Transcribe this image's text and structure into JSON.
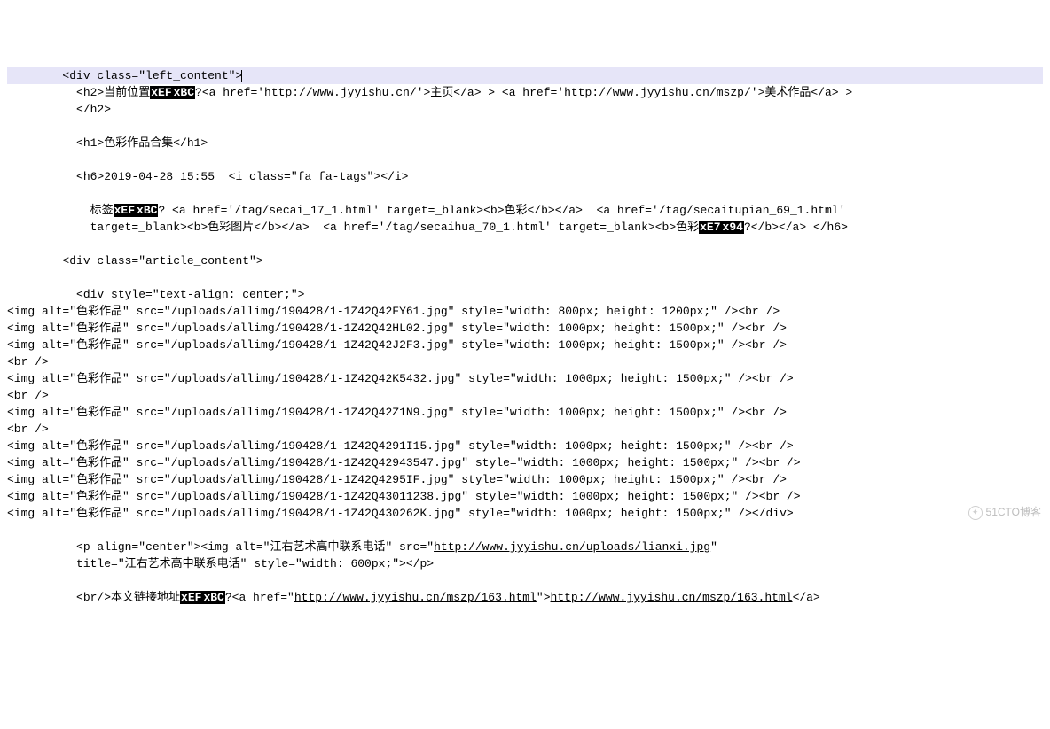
{
  "lines": [
    {
      "indent": "        ",
      "highlight": true,
      "segments": [
        {
          "t": "plain",
          "v": "<div class=\"left_content\">"
        },
        {
          "t": "caret"
        }
      ]
    },
    {
      "indent": "          ",
      "segments": [
        {
          "t": "plain",
          "v": "<h2>当前位置"
        },
        {
          "t": "hex",
          "v": "xEF"
        },
        {
          "t": "hex",
          "v": "xBC"
        },
        {
          "t": "plain",
          "v": "?<a href='"
        },
        {
          "t": "url",
          "v": "http://www.jyyishu.cn/"
        },
        {
          "t": "plain",
          "v": "'>主页</a> > <a href='"
        },
        {
          "t": "url",
          "v": "http://www.jyyishu.cn/mszp/"
        },
        {
          "t": "plain",
          "v": "'>美术作品</a> >"
        }
      ]
    },
    {
      "indent": "          ",
      "segments": [
        {
          "t": "plain",
          "v": "</h2>"
        }
      ]
    },
    {
      "indent": "",
      "segments": [
        {
          "t": "plain",
          "v": ""
        }
      ]
    },
    {
      "indent": "          ",
      "segments": [
        {
          "t": "plain",
          "v": "<h1>色彩作品合集</h1>"
        }
      ]
    },
    {
      "indent": "",
      "segments": [
        {
          "t": "plain",
          "v": ""
        }
      ]
    },
    {
      "indent": "          ",
      "segments": [
        {
          "t": "plain",
          "v": "<h6>2019-04-28 15:55  <i class=\"fa fa-tags\"></i>"
        }
      ]
    },
    {
      "indent": "",
      "segments": [
        {
          "t": "plain",
          "v": ""
        }
      ]
    },
    {
      "indent": "            ",
      "segments": [
        {
          "t": "plain",
          "v": "标签"
        },
        {
          "t": "hex",
          "v": "xEF"
        },
        {
          "t": "hex",
          "v": "xBC"
        },
        {
          "t": "plain",
          "v": "? <a href='/tag/secai_17_1.html' target=_blank><b>色彩</b></a>  <a href='/tag/secaitupian_69_1.html'"
        }
      ]
    },
    {
      "indent": "            ",
      "segments": [
        {
          "t": "plain",
          "v": "target=_blank><b>色彩图片</b></a>  <a href='/tag/secaihua_70_1.html' target=_blank><b>色彩"
        },
        {
          "t": "hex",
          "v": "xE7"
        },
        {
          "t": "hex",
          "v": "x94"
        },
        {
          "t": "plain",
          "v": "?</b></a> </h6>"
        }
      ]
    },
    {
      "indent": "",
      "segments": [
        {
          "t": "plain",
          "v": ""
        }
      ]
    },
    {
      "indent": "        ",
      "segments": [
        {
          "t": "plain",
          "v": "<div class=\"article_content\">"
        }
      ]
    },
    {
      "indent": "",
      "segments": [
        {
          "t": "plain",
          "v": ""
        }
      ]
    },
    {
      "indent": "          ",
      "segments": [
        {
          "t": "plain",
          "v": "<div style=\"text-align: center;\">"
        }
      ]
    },
    {
      "indent": "",
      "segments": [
        {
          "t": "plain",
          "v": "<img alt=\"色彩作品\" src=\"/uploads/allimg/190428/1-1Z42Q42FY61.jpg\" style=\"width: 800px; height: 1200px;\" /><br />"
        }
      ]
    },
    {
      "indent": "",
      "segments": [
        {
          "t": "plain",
          "v": "<img alt=\"色彩作品\" src=\"/uploads/allimg/190428/1-1Z42Q42HL02.jpg\" style=\"width: 1000px; height: 1500px;\" /><br />"
        }
      ]
    },
    {
      "indent": "",
      "segments": [
        {
          "t": "plain",
          "v": "<img alt=\"色彩作品\" src=\"/uploads/allimg/190428/1-1Z42Q42J2F3.jpg\" style=\"width: 1000px; height: 1500px;\" /><br />"
        }
      ]
    },
    {
      "indent": "",
      "segments": [
        {
          "t": "plain",
          "v": "<br />"
        }
      ]
    },
    {
      "indent": "",
      "segments": [
        {
          "t": "plain",
          "v": "<img alt=\"色彩作品\" src=\"/uploads/allimg/190428/1-1Z42Q42K5432.jpg\" style=\"width: 1000px; height: 1500px;\" /><br />"
        }
      ]
    },
    {
      "indent": "",
      "segments": [
        {
          "t": "plain",
          "v": "<br />"
        }
      ]
    },
    {
      "indent": "",
      "segments": [
        {
          "t": "plain",
          "v": "<img alt=\"色彩作品\" src=\"/uploads/allimg/190428/1-1Z42Q42Z1N9.jpg\" style=\"width: 1000px; height: 1500px;\" /><br />"
        }
      ]
    },
    {
      "indent": "",
      "segments": [
        {
          "t": "plain",
          "v": "<br />"
        }
      ]
    },
    {
      "indent": "",
      "segments": [
        {
          "t": "plain",
          "v": "<img alt=\"色彩作品\" src=\"/uploads/allimg/190428/1-1Z42Q4291I15.jpg\" style=\"width: 1000px; height: 1500px;\" /><br />"
        }
      ]
    },
    {
      "indent": "",
      "segments": [
        {
          "t": "plain",
          "v": "<img alt=\"色彩作品\" src=\"/uploads/allimg/190428/1-1Z42Q42943547.jpg\" style=\"width: 1000px; height: 1500px;\" /><br />"
        }
      ]
    },
    {
      "indent": "",
      "segments": [
        {
          "t": "plain",
          "v": "<img alt=\"色彩作品\" src=\"/uploads/allimg/190428/1-1Z42Q4295IF.jpg\" style=\"width: 1000px; height: 1500px;\" /><br />"
        }
      ]
    },
    {
      "indent": "",
      "segments": [
        {
          "t": "plain",
          "v": "<img alt=\"色彩作品\" src=\"/uploads/allimg/190428/1-1Z42Q43011238.jpg\" style=\"width: 1000px; height: 1500px;\" /><br />"
        }
      ]
    },
    {
      "indent": "",
      "segments": [
        {
          "t": "plain",
          "v": "<img alt=\"色彩作品\" src=\"/uploads/allimg/190428/1-1Z42Q430262K.jpg\" style=\"width: 1000px; height: 1500px;\" /></div>"
        }
      ]
    },
    {
      "indent": "",
      "segments": [
        {
          "t": "plain",
          "v": ""
        }
      ]
    },
    {
      "indent": "          ",
      "segments": [
        {
          "t": "plain",
          "v": "<p align=\"center\"><img alt=\"江右艺术高中联系电话\" src=\""
        },
        {
          "t": "url",
          "v": "http://www.jyyishu.cn/uploads/lianxi.jpg"
        },
        {
          "t": "plain",
          "v": "\""
        }
      ]
    },
    {
      "indent": "          ",
      "segments": [
        {
          "t": "plain",
          "v": "title=\"江右艺术高中联系电话\" style=\"width: 600px;\"></p>"
        }
      ]
    },
    {
      "indent": "",
      "segments": [
        {
          "t": "plain",
          "v": ""
        }
      ]
    },
    {
      "indent": "          ",
      "segments": [
        {
          "t": "plain",
          "v": "<br/>本文链接地址"
        },
        {
          "t": "hex",
          "v": "xEF"
        },
        {
          "t": "hex",
          "v": "xBC"
        },
        {
          "t": "plain",
          "v": "?<a href=\""
        },
        {
          "t": "url",
          "v": "http://www.jyyishu.cn/mszp/163.html"
        },
        {
          "t": "plain",
          "v": "\">"
        },
        {
          "t": "url",
          "v": "http://www.jyyishu.cn/mszp/163.html"
        },
        {
          "t": "plain",
          "v": "</a>"
        }
      ]
    }
  ],
  "watermark": "51CTO博客"
}
